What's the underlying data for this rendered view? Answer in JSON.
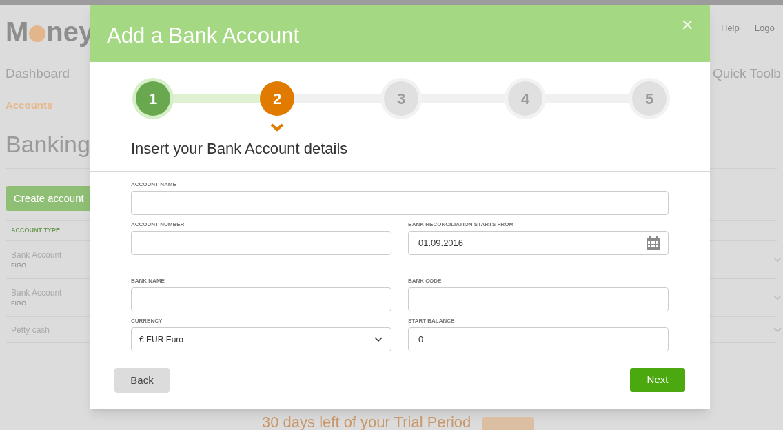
{
  "background": {
    "logo": {
      "lead": "M",
      "tail": "ney"
    },
    "top_links": [
      "Help",
      "Logo"
    ],
    "nav": {
      "left": "Dashboard",
      "right": "Quick Toolb"
    },
    "section": "Accounts",
    "page_title": "Banking",
    "create_button": "Create account",
    "table": {
      "columns": [
        "ACCOUNT TYPE"
      ],
      "rows": [
        {
          "name": "Bank Account",
          "sub": "FIGO"
        },
        {
          "name": "Bank Account",
          "sub": "FIGO"
        },
        {
          "name": "Petty cash"
        }
      ]
    },
    "trial_text": "30 days left of your Trial Period"
  },
  "dialog": {
    "title": "Add a Bank Account",
    "close": "×",
    "steps": [
      {
        "label": "1",
        "done": true,
        "selected": false
      },
      {
        "label": "2",
        "done": false,
        "selected": true
      },
      {
        "label": "3",
        "done": false,
        "selected": false
      },
      {
        "label": "4",
        "done": false,
        "selected": false
      },
      {
        "label": "5",
        "done": false,
        "selected": false
      }
    ],
    "heading": "Insert your Bank Account details",
    "rows": [
      [
        {
          "label": "ACCOUNT NAME",
          "kind": "text"
        }
      ],
      [
        {
          "label": "ACCOUNT NUMBER",
          "kind": "text"
        },
        {
          "label": "BANK RECONCILIATION STARTS FROM",
          "kind": "date",
          "value": "01.09.2016"
        }
      ],
      [
        {
          "label": "BANK NAME",
          "kind": "text"
        },
        {
          "label": "BANK CODE",
          "kind": "text"
        }
      ],
      [
        {
          "label": "CURRENCY",
          "kind": "select",
          "value": "€ EUR Euro"
        },
        {
          "label": "START BALANCE",
          "kind": "text",
          "value": "0"
        }
      ]
    ],
    "buttons": {
      "back": "Back",
      "next": "Next"
    }
  }
}
